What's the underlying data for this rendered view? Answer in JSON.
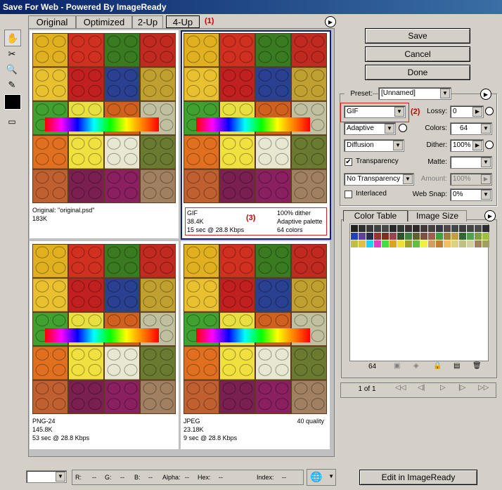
{
  "window": {
    "title": "Save For Web - Powered By ImageReady"
  },
  "tabs": [
    {
      "label": "Original"
    },
    {
      "label": "Optimized"
    },
    {
      "label": "2-Up"
    },
    {
      "label": "4-Up"
    }
  ],
  "annotations": {
    "a1": "(1)",
    "a2": "(2)",
    "a3": "(3)"
  },
  "panes": [
    {
      "line1": "Original: \"original.psd\"",
      "line2": "183K",
      "line3": "",
      "right1": "",
      "right2": "",
      "right3": ""
    },
    {
      "line1": "GIF",
      "line2": "38.4K",
      "line3": "15 sec @ 28.8 Kbps",
      "right1": "100% dither",
      "right2": "Adaptive palette",
      "right3": "64 colors"
    },
    {
      "line1": "PNG-24",
      "line2": "145.8K",
      "line3": "53 sec @ 28.8 Kbps",
      "right1": "",
      "right2": "",
      "right3": ""
    },
    {
      "line1": "JPEG",
      "line2": "23.18K",
      "line3": "9 sec @ 28.8 Kbps",
      "right1": "40 quality",
      "right2": "",
      "right3": ""
    }
  ],
  "buttons": {
    "save": "Save",
    "cancel": "Cancel",
    "done": "Done",
    "edit": "Edit in ImageReady"
  },
  "settings": {
    "preset_label": "Preset:",
    "preset_value": "[Unnamed]",
    "format": "GIF",
    "lossy_label": "Lossy:",
    "lossy_value": "0",
    "palette": "Adaptive",
    "colors_label": "Colors:",
    "colors_value": "64",
    "dither_algo": "Diffusion",
    "dither_label": "Dither:",
    "dither_value": "100%",
    "transparency_label": "Transparency",
    "matte_label": "Matte:",
    "transparency_dither": "No Transparency ...",
    "amount_label": "Amount:",
    "amount_value": "100%",
    "interlaced_label": "Interlaced",
    "websnap_label": "Web Snap:",
    "websnap_value": "0%"
  },
  "color_table": {
    "tab_colors": "Color Table",
    "tab_size": "Image Size",
    "count": "64",
    "colors": [
      "#202020",
      "#303030",
      "#383838",
      "#404040",
      "#484848",
      "#282828",
      "#303830",
      "#383030",
      "#302828",
      "#403838",
      "#484040",
      "#383840",
      "#504848",
      "#404848",
      "#3a3a3a",
      "#444444",
      "#4a4a4a",
      "#2c2c2c",
      "#2040c0",
      "#6040a0",
      "#2a2a50",
      "#a03030",
      "#803020",
      "#a04050",
      "#305030",
      "#408040",
      "#606030",
      "#805040",
      "#a06050",
      "#40a040",
      "#a08040",
      "#c0a040",
      "#306830",
      "#50a050",
      "#80a040",
      "#a0c040",
      "#c0c040",
      "#e0c040",
      "#20d0f0",
      "#e040c0",
      "#40e040",
      "#e0a020",
      "#f0e030",
      "#a0a030",
      "#60c040",
      "#f0f040",
      "#d0a060",
      "#c08030",
      "#f0c060",
      "#e0d080",
      "#c0c080",
      "#d0d0a0",
      "#a08060",
      "#a0a060"
    ],
    "pager": "1 of 1"
  },
  "statusbar": {
    "r": "R:",
    "r_val": "--",
    "g": "G:",
    "g_val": "--",
    "b": "B:",
    "b_val": "--",
    "alpha": "Alpha:",
    "alpha_val": "--",
    "hex": "Hex:",
    "hex_val": "--",
    "index": "Index:",
    "index_val": "--"
  }
}
